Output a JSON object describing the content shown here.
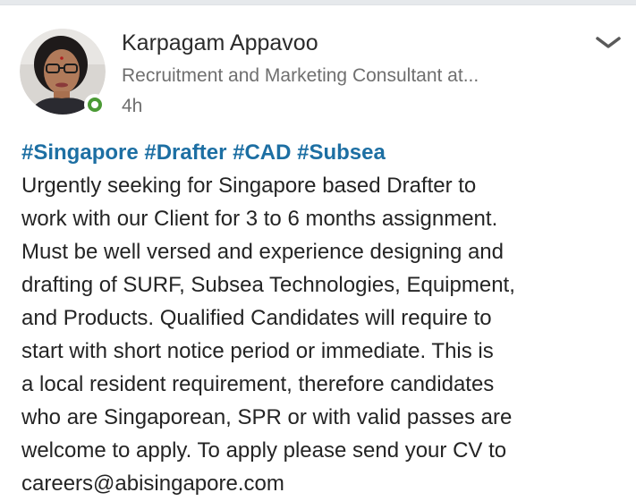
{
  "post": {
    "author": {
      "name": "Karpagam Appavoo",
      "headline": "Recruitment and Marketing Consultant at...",
      "time": "4h"
    },
    "hashtags": [
      "#Singapore",
      "#Drafter",
      "#CAD",
      "#Subsea"
    ],
    "body_lines": [
      "Urgently seeking for Singapore based Drafter to",
      "work with our Client for 3 to 6 months assignment.",
      "Must be well versed and experience designing and",
      "drafting of SURF, Subsea Technologies, Equipment,",
      "and Products. Qualified Candidates will require to",
      "start with short notice period or immediate. This is",
      "a local resident requirement, therefore candidates",
      "who are Singaporean, SPR or with valid passes are",
      "welcome to apply. To apply please send your CV to",
      "careers@abisingapore.com"
    ]
  },
  "icons": {
    "avatar": "avatar-photo",
    "presence": "online-status-icon",
    "menu": "chevron-down-icon"
  },
  "colors": {
    "hashtag": "#1d6fa3",
    "presence": "#4b9a35",
    "text_primary": "#242424",
    "text_secondary": "#6f6f6f"
  }
}
